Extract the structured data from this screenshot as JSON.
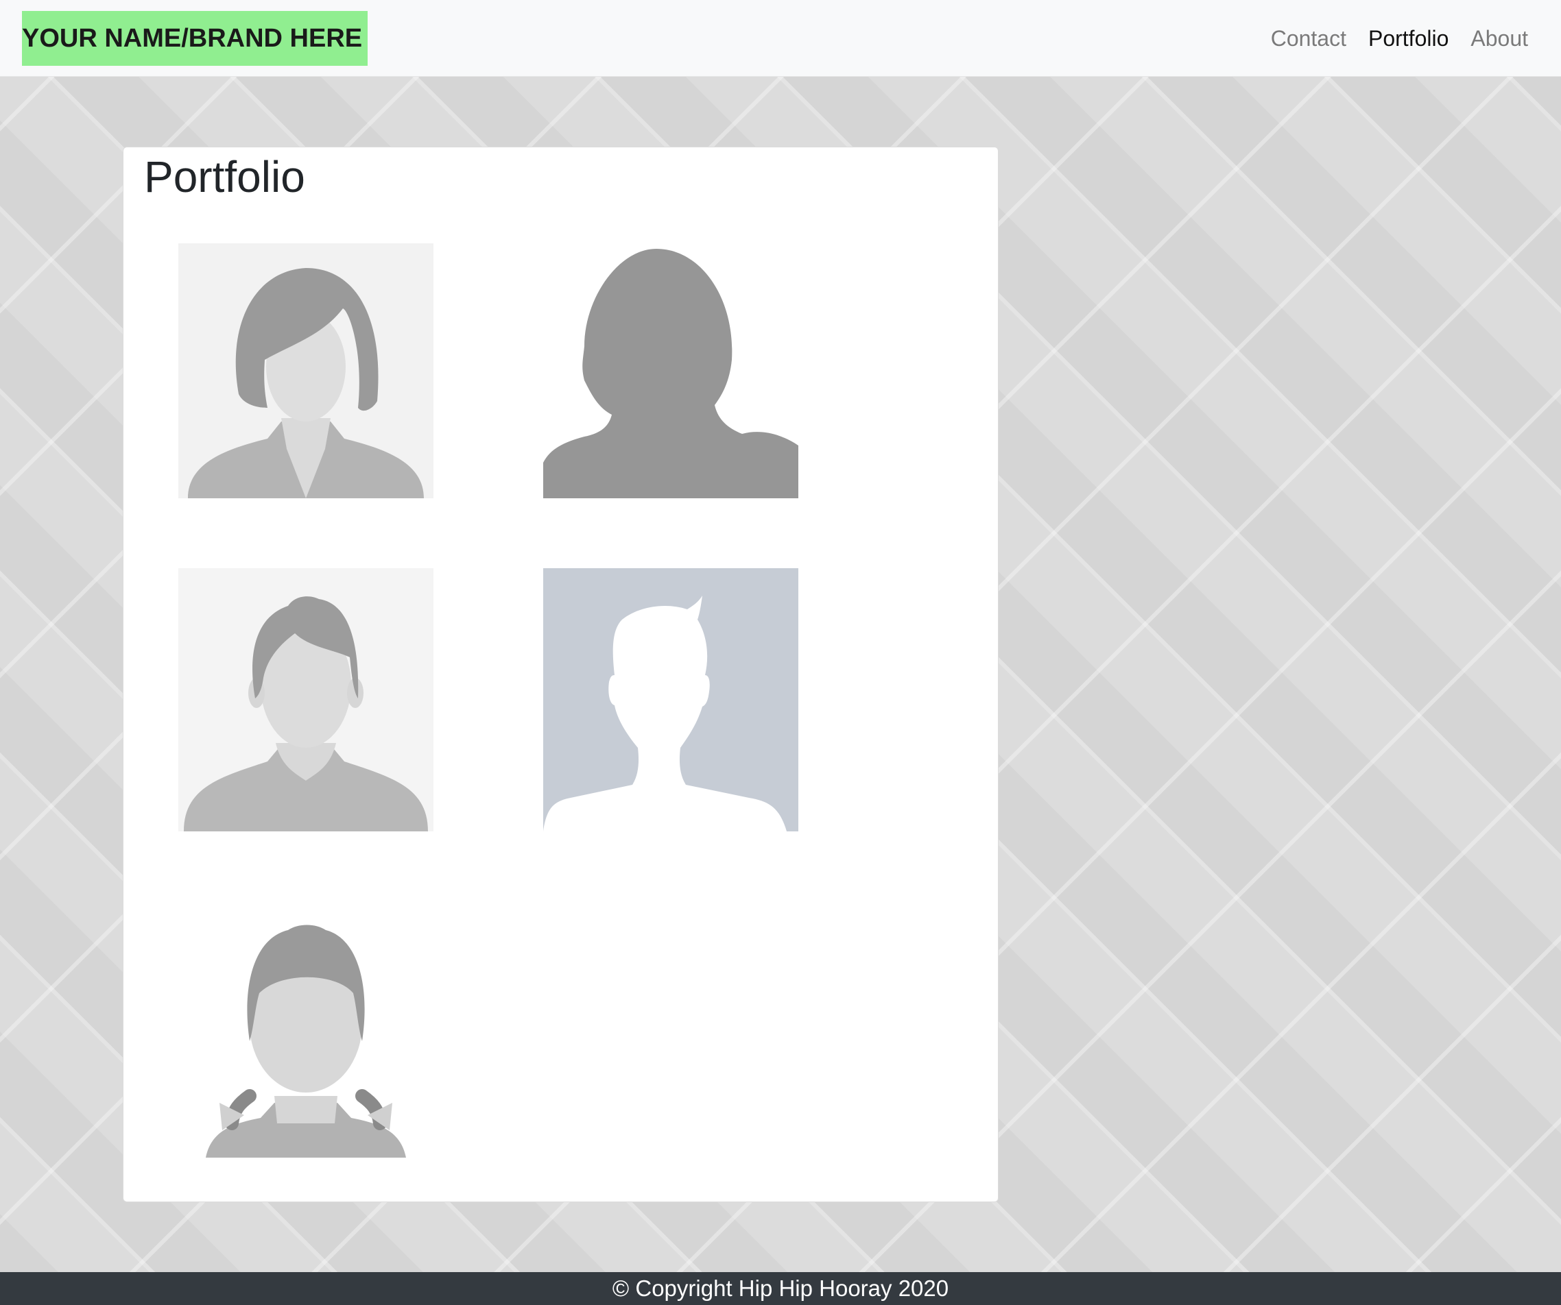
{
  "navbar": {
    "brand": "YOUR NAME/BRAND HERE",
    "links": [
      {
        "label": "Contact",
        "active": false
      },
      {
        "label": "Portfolio",
        "active": true
      },
      {
        "label": "About",
        "active": false
      }
    ]
  },
  "main": {
    "title": "Portfolio",
    "images": [
      {
        "icon": "woman-avatar-placeholder-icon"
      },
      {
        "icon": "woman-silhouette-icon"
      },
      {
        "icon": "man-avatar-placeholder-icon"
      },
      {
        "icon": "man-silhouette-icon"
      },
      {
        "icon": "girl-with-braids-avatar-icon"
      }
    ]
  },
  "footer": {
    "text": "© Copyright Hip Hip Hooray 2020"
  },
  "colors": {
    "brand_highlight": "#90ee90",
    "footer_bg": "#343a40",
    "navbar_bg": "#f8f9fa"
  }
}
